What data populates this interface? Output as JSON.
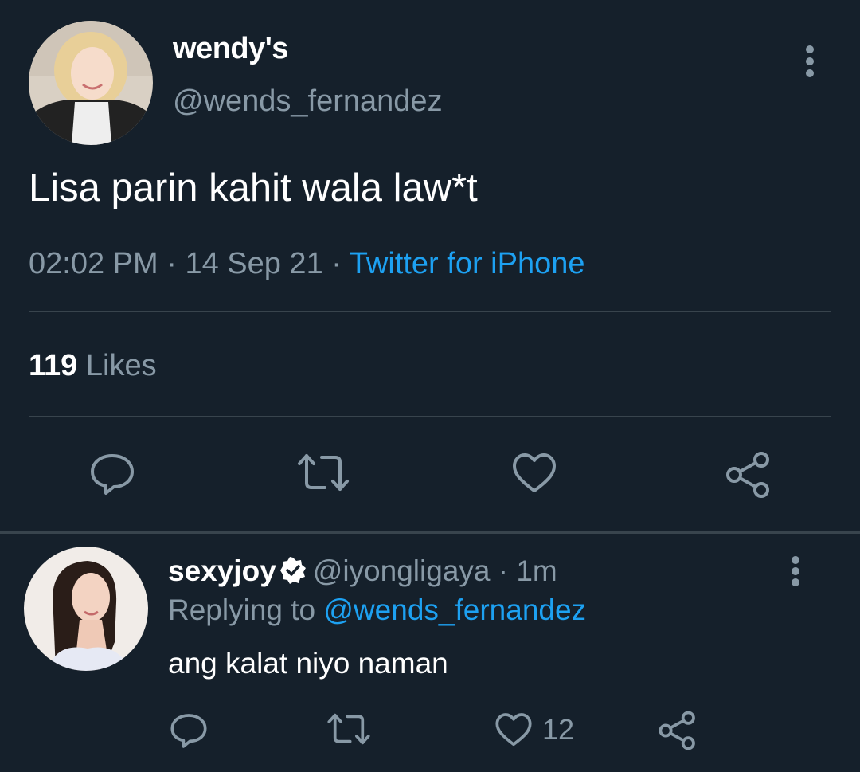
{
  "main_tweet": {
    "display_name": "wendy's",
    "handle": "@wends_fernandez",
    "text": "Lisa parin kahit wala law*t",
    "time": "02:02 PM",
    "date": "14 Sep 21",
    "source": "Twitter for iPhone",
    "likes_count": "119",
    "likes_label": "Likes",
    "separator": "·",
    "actions": [
      "reply-icon",
      "retweet-icon",
      "like-icon",
      "share-icon"
    ]
  },
  "reply": {
    "display_name": "sexyjoy",
    "verified": true,
    "handle": "@iyongligaya",
    "age": "1m",
    "separator": "·",
    "replying_label": "Replying to",
    "replying_to": "@wends_fernandez",
    "text": "ang kalat niyo naman",
    "like_count": "12",
    "actions": [
      "reply-icon",
      "retweet-icon",
      "like-icon",
      "share-icon"
    ]
  },
  "colors": {
    "background": "#15202b",
    "primary_text": "#ffffff",
    "secondary_text": "#8899a6",
    "link": "#1da1f2",
    "divider": "#38444d"
  }
}
